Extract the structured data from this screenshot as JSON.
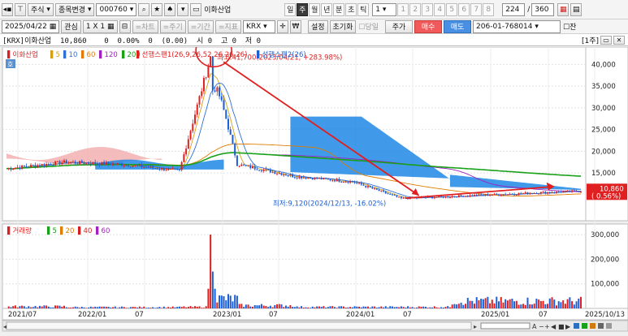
{
  "toolbar1": {
    "market_label": "주식",
    "change_label": "종목변경",
    "code": "000760",
    "name": "이화산업",
    "period_tabs": [
      "일",
      "주",
      "월",
      "년",
      "분",
      "초",
      "틱"
    ],
    "active_period": "주",
    "interval_value": "1",
    "number_buttons": [
      "1",
      "2",
      "3",
      "4",
      "5",
      "6",
      "7",
      "8"
    ],
    "count_value": "224",
    "count_total": "360"
  },
  "toolbar2": {
    "date": "2025/04/22",
    "watch_label": "관심",
    "grid_label": "1 X 1",
    "chart_label": "=차트",
    "indicator_labels": [
      "=주기",
      "=기간",
      "=지표"
    ],
    "exchange": "KRX",
    "currency_icon": "₩",
    "settings_label": "설정",
    "reset_label": "초기화",
    "sameday_label": "당일",
    "price_label": "주가",
    "buy_label": "매수",
    "sell_label": "매도",
    "account": "206-01-768014",
    "extra_label": "잔"
  },
  "infobar": {
    "text": "[KRX]이화산업  10,860    0  0.00%  0  (0.00)  시 0  고 0  저 0",
    "counter": "[1주]"
  },
  "main_legend": {
    "name": "이화산업",
    "ma": [
      {
        "label": "5",
        "color": "#d4a017"
      },
      {
        "label": "10",
        "color": "#2f6fd8"
      },
      {
        "label": "60",
        "color": "#e07c00"
      },
      {
        "label": "120",
        "color": "#a020c0"
      },
      {
        "label": "200",
        "color": "#18a018"
      }
    ],
    "span1": "선행스팬1(26,9,26,52,26,26,26)",
    "span2": "선행스팬2(26)",
    "tag": "호"
  },
  "annotations": {
    "high": "최고:41,700(2023/04/21, +283.98%)",
    "low": "최저:9,120(2024/12/13, -16.02%)"
  },
  "price_axis": [
    "40,000",
    "35,000",
    "30,000",
    "25,000",
    "20,000",
    "15,000"
  ],
  "price_tag": {
    "value": "10,860",
    "change": "(  0.56%)"
  },
  "volume_legend": {
    "name": "거래량",
    "ma": [
      {
        "label": "5",
        "color": "#18a018"
      },
      {
        "label": "20",
        "color": "#e07c00"
      },
      {
        "label": "40",
        "color": "#d02020"
      },
      {
        "label": "60",
        "color": "#a020c0"
      }
    ]
  },
  "volume_axis": [
    "300,000",
    "200,000",
    "100,000"
  ],
  "x_axis": [
    "2021/07",
    "2022/01",
    "07",
    "2023/01",
    "07",
    "2024/01",
    "07",
    "2025/01",
    "07",
    "2025/10/13"
  ],
  "colors": {
    "up": "#e02020",
    "down": "#1b5fd8",
    "cloud_blue": "#1e88e5",
    "cloud_red": "#f2b0b0"
  },
  "chart_data": [
    {
      "type": "line",
      "title": "이화산업",
      "x": [
        "2021/07",
        "2022/01",
        "2022/07",
        "2023/01",
        "2023/04",
        "2023/07",
        "2024/01",
        "2024/07",
        "2024/12",
        "2025/04"
      ],
      "series": [
        {
          "name": "이화산업",
          "values": [
            16000,
            17500,
            17000,
            15500,
            41700,
            17000,
            14200,
            13000,
            9120,
            10860
          ]
        }
      ],
      "ylim": [
        9000,
        44000
      ]
    },
    {
      "type": "bar",
      "title": "거래량",
      "x": [
        "2021/07",
        "2022/01",
        "2022/07",
        "2023/01",
        "2023/04",
        "2023/07",
        "2024/01",
        "2024/07",
        "2025/01"
      ],
      "values": [
        10000,
        8000,
        5000,
        6000,
        300000,
        40000,
        12000,
        6000,
        30000
      ],
      "ylim": [
        0,
        330000
      ]
    }
  ]
}
